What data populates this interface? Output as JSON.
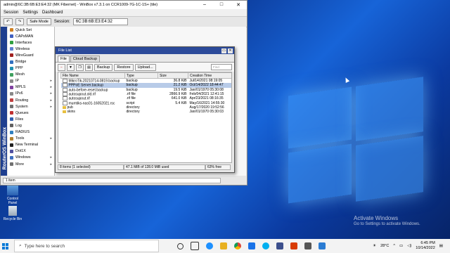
{
  "winbox": {
    "title": "admin@6C:3B:6B:E3:E4:32 (MK Fibernet) - WinBox v7.3.1 on CCR1009-7G-1C-1S+ (tile)",
    "menu": [
      "Session",
      "Settings",
      "Dashboard"
    ],
    "safe_mode": "Safe Mode",
    "session_label": "Session:",
    "session_value": "6C:3B:6B:E3:E4:32",
    "brand_strip": "RouterOS WinBox",
    "status": "1 item",
    "sidebar": [
      {
        "label": "Quick Set",
        "icon": "quickset-icon",
        "color": "#d08020",
        "arrow": false
      },
      {
        "label": "CAPsMAN",
        "icon": "capsman-icon",
        "color": "#4060c0",
        "arrow": false
      },
      {
        "label": "Interfaces",
        "icon": "interfaces-icon",
        "color": "#30a040",
        "arrow": false
      },
      {
        "label": "Wireless",
        "icon": "wireless-icon",
        "color": "#6080d0",
        "arrow": false
      },
      {
        "label": "WireGuard",
        "icon": "wireguard-icon",
        "color": "#a02020",
        "arrow": false
      },
      {
        "label": "Bridge",
        "icon": "bridge-icon",
        "color": "#3070c0",
        "arrow": false
      },
      {
        "label": "PPP",
        "icon": "ppp-icon",
        "color": "#2090b0",
        "arrow": false
      },
      {
        "label": "Mesh",
        "icon": "mesh-icon",
        "color": "#40a060",
        "arrow": false
      },
      {
        "label": "IP",
        "icon": "ip-icon",
        "color": "#888888",
        "arrow": true
      },
      {
        "label": "MPLS",
        "icon": "mpls-icon",
        "color": "#8040a0",
        "arrow": true
      },
      {
        "label": "IPv6",
        "icon": "ipv6-icon",
        "color": "#888888",
        "arrow": true
      },
      {
        "label": "Routing",
        "icon": "routing-icon",
        "color": "#c04040",
        "arrow": true
      },
      {
        "label": "System",
        "icon": "system-icon",
        "color": "#707070",
        "arrow": true
      },
      {
        "label": "Queues",
        "icon": "queues-icon",
        "color": "#c03030",
        "arrow": false
      },
      {
        "label": "Files",
        "icon": "files-icon",
        "color": "#3060b0",
        "arrow": false
      },
      {
        "label": "Log",
        "icon": "log-icon",
        "color": "#606060",
        "arrow": false
      },
      {
        "label": "RADIUS",
        "icon": "radius-icon",
        "color": "#3080c0",
        "arrow": false
      },
      {
        "label": "Tools",
        "icon": "tools-icon",
        "color": "#b08030",
        "arrow": true
      },
      {
        "label": "New Terminal",
        "icon": "terminal-icon",
        "color": "#202020",
        "arrow": false
      },
      {
        "label": "Dot1X",
        "icon": "dot1x-icon",
        "color": "#5050a0",
        "arrow": false
      },
      {
        "label": "Windows",
        "icon": "windows-icon",
        "color": "#4070c0",
        "arrow": true
      },
      {
        "label": "More",
        "icon": "more-icon",
        "color": "#707070",
        "arrow": true
      }
    ]
  },
  "file_list": {
    "title": "File List",
    "tabs": [
      "File",
      "Cloud Backup"
    ],
    "buttons": {
      "backup": "Backup",
      "restore": "Restore",
      "upload": "Upload..."
    },
    "find_placeholder": "Find",
    "columns": [
      "File Name",
      "Type",
      "Size",
      "Creation Time"
    ],
    "rows": [
      {
        "name": "MikroTik-20210714-0819.backup",
        "type": "backup",
        "size": "36.8 KiB",
        "time": "Jul/14/2021 08:19:05",
        "kind": "file",
        "selected": false
      },
      {
        "name": "PPPoE Server.backup",
        "type": "backup",
        "size": "21.2 KiB",
        "time": "Oct/14/2022 18:44:47",
        "kind": "file",
        "selected": true
      },
      {
        "name": "auto-before-reset.backup",
        "type": "backup",
        "size": "19.5 KiB",
        "time": "Jan/01/1970 05:30:08",
        "kind": "file",
        "selected": false
      },
      {
        "name": "autosupout.old.rif",
        "type": ".rif file",
        "size": "2866.9 KiB",
        "time": "Feb/04/2021 12:41:15",
        "kind": "file",
        "selected": false
      },
      {
        "name": "autosupout.rif",
        "type": ".rif file",
        "size": "641.0 KiB",
        "time": "Apr/23/2021 08:16:35",
        "kind": "file",
        "selected": false
      },
      {
        "name": "mumtiks-nas01-16052021.rsc",
        "type": "script",
        "size": "5.4 KiB",
        "time": "May/16/2021 14:55:30",
        "kind": "file",
        "selected": false
      },
      {
        "name": "pub",
        "type": "directory",
        "size": "",
        "time": "Aug/17/2020 19:52:56",
        "kind": "dir",
        "selected": false
      },
      {
        "name": "skins",
        "type": "directory",
        "size": "",
        "time": "Jan/01/1970 05:30:03",
        "kind": "dir",
        "selected": false
      }
    ],
    "status": {
      "count": "8 items (1 selected)",
      "usage": "47.1 MiB of 128.0 MiB used",
      "free": "63% free"
    }
  },
  "desktop": {
    "icons": [
      {
        "label": "Control Panel",
        "icon": "control-panel-icon"
      },
      {
        "label": "Recycle Bin",
        "icon": "recycle-bin-icon"
      }
    ],
    "activate_title": "Activate Windows",
    "activate_sub": "Go to Settings to activate Windows."
  },
  "taskbar": {
    "search_placeholder": "Type here to search",
    "temperature": "28°C",
    "time": "6:45 PM",
    "date": "10/14/2022"
  }
}
